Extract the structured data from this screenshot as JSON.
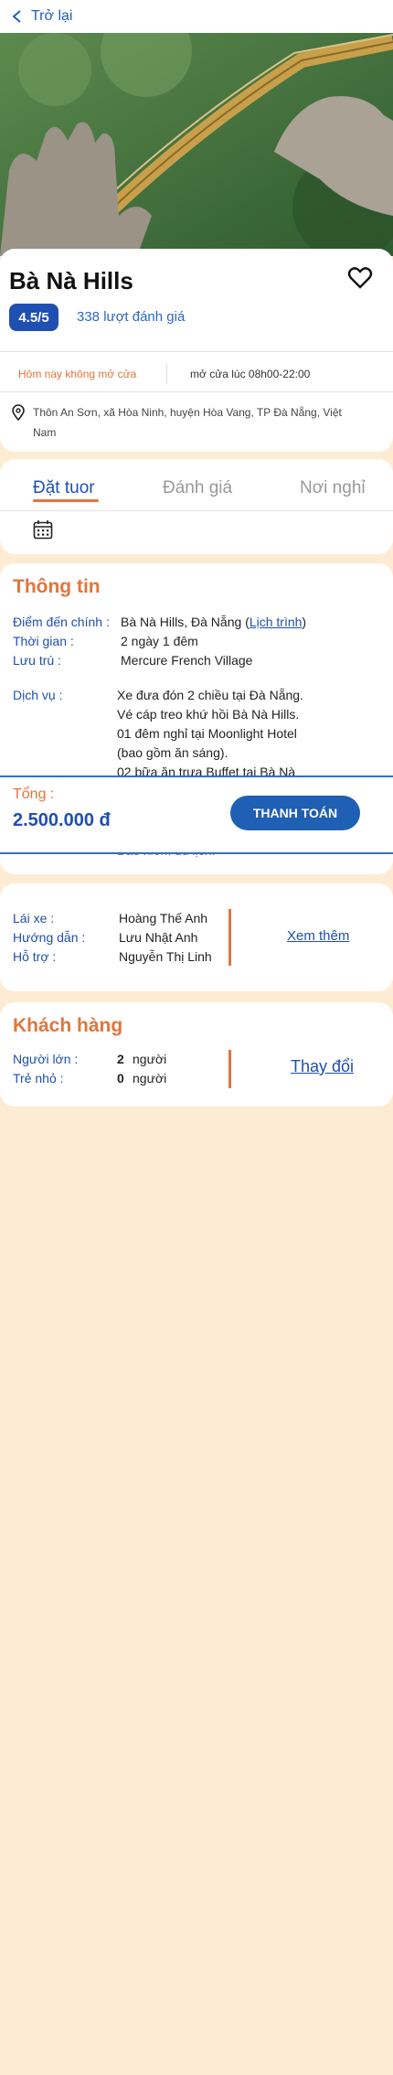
{
  "header": {
    "back_label": "Trở lại"
  },
  "place": {
    "name": "Bà Nà Hills",
    "rating": "4.5/5",
    "reviews": "338 lượt đánh giá",
    "status": "Hôm nay không mở cửa",
    "hours": "mở cửa lúc 08h00-22:00",
    "address": "Thôn An Sơn, xã Hòa Ninh, huyện Hòa Vang, TP Đà Nẵng, Việt Nam"
  },
  "tabs": [
    "Đặt tuor",
    "Đánh giá",
    "Nơi nghỉ"
  ],
  "info": {
    "title": "Thông tin",
    "destination_label": "Điểm đến chính :",
    "destination_value": "Bà Nà Hills, Đà Nẵng (",
    "schedule_link": "Lịch trình",
    "destination_close": ")",
    "time_label": "Thời gian :",
    "time_value": "2 ngày 1 đêm",
    "stay_label": "Lưu trú :",
    "stay_value": "Mercure French Village",
    "service_label": "Dịch vụ :",
    "service_lines": [
      "Xe đưa đón 2 chiều tại Đà Nẵng.",
      "Vé cáp treo khứ hồi Bà Nà Hills.",
      "01 đêm nghỉ tại Moonlight Hotel",
      "(bao gồm ăn sáng).",
      "02 bữa ăn trưa Buffet tại Bà Nà"
    ],
    "insurance_tail": "Bảo hiểm du lịch."
  },
  "staff": {
    "driver_label": "Lái xe :",
    "driver_value": "Hoàng Thế Anh",
    "guide_label": "Hướng dẫn :",
    "guide_value": "Lưu Nhật Anh",
    "support_label": "Hỗ trợ :",
    "support_value": "Nguyễn Thị Linh",
    "see_more": "Xem thêm"
  },
  "customers": {
    "title": "Khách hàng",
    "adult_label": "Người lớn :",
    "adult_count": "2",
    "adult_unit": "người",
    "child_label": "Trẻ nhỏ :",
    "child_count": "0",
    "child_unit": "người",
    "change": "Thay đổi"
  },
  "checkout": {
    "total_label": "Tổng :",
    "total_value": "2.500.000 đ",
    "pay_button": "THANH TOÁN"
  },
  "colors": {
    "accent_orange": "#e2753b",
    "brand_blue": "#1f5fb4",
    "background": "#fdebd3"
  }
}
